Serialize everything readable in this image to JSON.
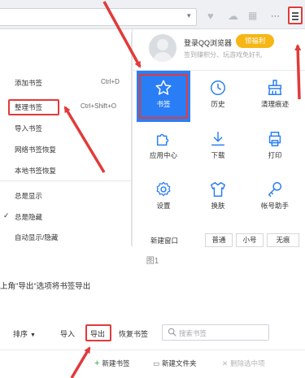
{
  "toolbar": {
    "more_icon": "···"
  },
  "left_menu": {
    "items": [
      {
        "label": "添加书签",
        "shortcut": "Ctrl+D"
      },
      {
        "label": "整理书签",
        "shortcut": "Ctrl+Shift+O"
      },
      {
        "label": "导入书签",
        "shortcut": ""
      },
      {
        "label": "网络书签恢复",
        "shortcut": ""
      },
      {
        "label": "本地书签恢复",
        "shortcut": ""
      },
      {
        "label": "总是显示",
        "shortcut": ""
      },
      {
        "label": "总是隐藏",
        "shortcut": ""
      },
      {
        "label": "自动显示/隐藏",
        "shortcut": ""
      }
    ]
  },
  "panel": {
    "login_title": "登录QQ浏览器",
    "login_subtitle": "签到赚积分、玩游戏免好礼",
    "welfare_badge": "领福利",
    "grid": [
      {
        "label": "书签",
        "icon": "star-icon"
      },
      {
        "label": "历史",
        "icon": "clock-icon"
      },
      {
        "label": "清理痕迹",
        "icon": "broom-icon"
      },
      {
        "label": "应用中心",
        "icon": "puzzle-icon"
      },
      {
        "label": "下载",
        "icon": "download-icon"
      },
      {
        "label": "打印",
        "icon": "printer-icon"
      },
      {
        "label": "设置",
        "icon": "gear-icon"
      },
      {
        "label": "换肤",
        "icon": "shirt-icon"
      },
      {
        "label": "帐号助手",
        "icon": "key-icon"
      }
    ],
    "new_window": "新建窗口",
    "zoom_normal": "普通",
    "zoom_small": "小号",
    "zoom_seamless": "无痕"
  },
  "caption": "图1",
  "instruction": "上角\"导出\"选项将书签导出",
  "bookmark_toolbar": {
    "sort": "排序",
    "import": "导入",
    "export": "导出",
    "restore": "恢复书签",
    "search_placeholder": "搜索书签",
    "new_bookmark": "新建书签",
    "new_folder": "新建文件夹",
    "delete_selected": "删除选中项"
  },
  "colors": {
    "accent_red": "#e23a3a",
    "tile_blue": "#2a7ef5",
    "badge_orange": "#f6b614"
  }
}
